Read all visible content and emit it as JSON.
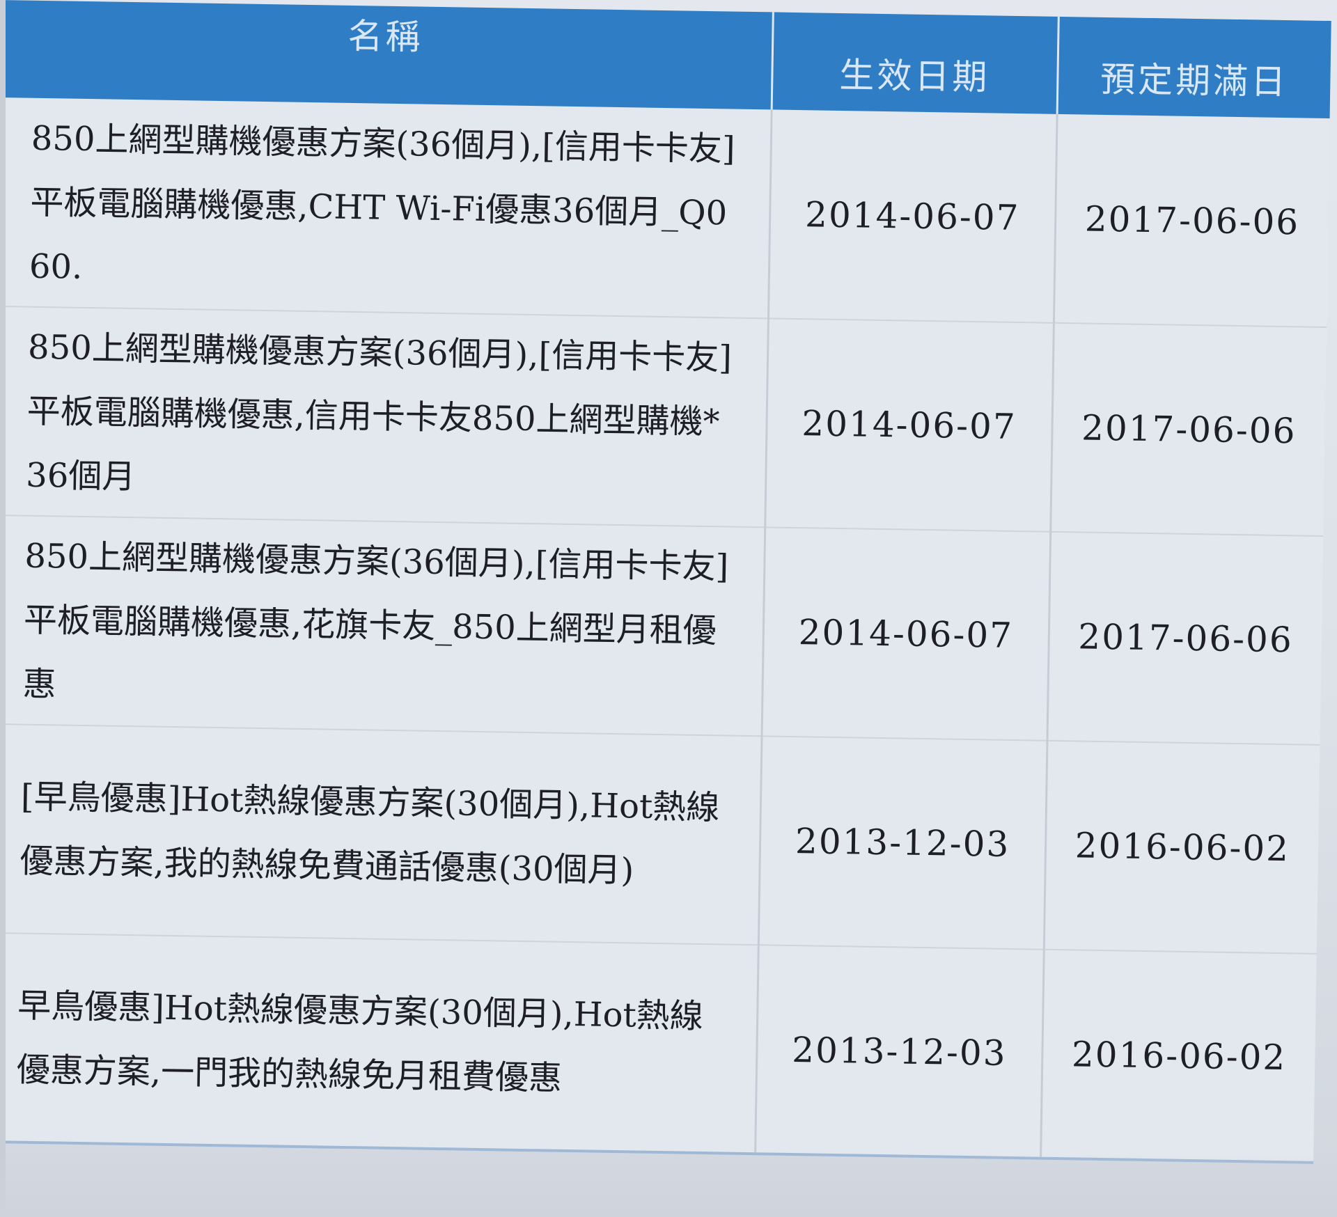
{
  "table": {
    "headers": {
      "name": "名稱",
      "start_date": "生效日期",
      "end_date": "預定期滿日"
    },
    "rows": [
      {
        "name": "850上網型購機優惠方案(36個月),[信用卡卡友]平板電腦購機優惠,CHT Wi-Fi優惠36個月_Q060.",
        "start_date": "2014-06-07",
        "end_date": "2017-06-06"
      },
      {
        "name": "850上網型購機優惠方案(36個月),[信用卡卡友]平板電腦購機優惠,信用卡卡友850上網型購機*36個月",
        "start_date": "2014-06-07",
        "end_date": "2017-06-06"
      },
      {
        "name": "850上網型購機優惠方案(36個月),[信用卡卡友]平板電腦購機優惠,花旗卡友_850上網型月租優惠",
        "start_date": "2014-06-07",
        "end_date": "2017-06-06"
      },
      {
        "name": "[早鳥優惠]Hot熱線優惠方案(30個月),Hot熱線優惠方案,我的熱線免費通話優惠(30個月)",
        "start_date": "2013-12-03",
        "end_date": "2016-06-02"
      },
      {
        "name": "早鳥優惠]Hot熱線優惠方案(30個月),Hot熱線優惠方案,一門我的熱線免月租費優惠",
        "start_date": "2013-12-03",
        "end_date": "2016-06-02"
      }
    ]
  },
  "colors": {
    "header_bg": "#2f7dc4",
    "header_text": "#d9e7f6",
    "table_bg": "#e3e7ee",
    "text": "#1d1f24"
  }
}
